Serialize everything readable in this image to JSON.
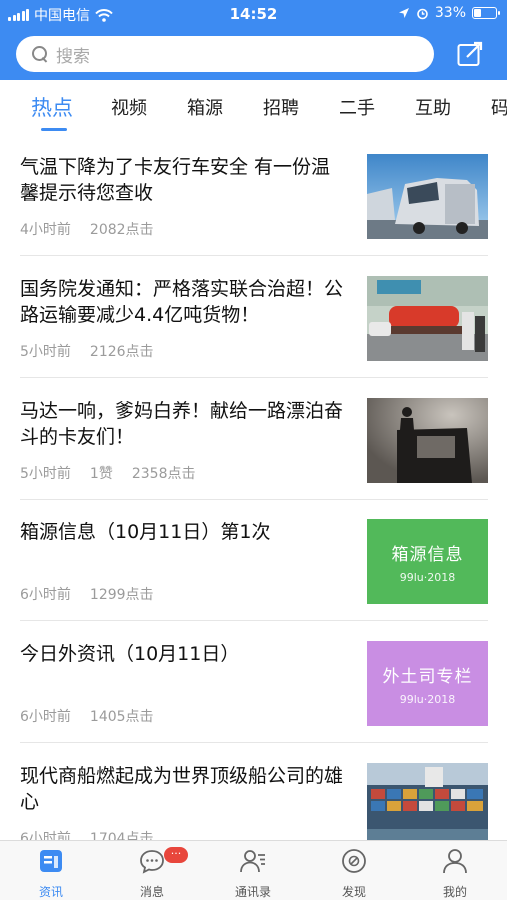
{
  "status_bar": {
    "carrier": "中国电信",
    "time": "14:52",
    "battery": "33%",
    "battery_level": 0.33
  },
  "header": {
    "search_placeholder": "搜索",
    "edit_icon": "compose-icon"
  },
  "tabs": [
    {
      "label": "热点",
      "active": true
    },
    {
      "label": "视频"
    },
    {
      "label": "箱源"
    },
    {
      "label": "招聘"
    },
    {
      "label": "二手"
    },
    {
      "label": "互助"
    },
    {
      "label": "码"
    }
  ],
  "articles": [
    {
      "title": "气温下降为了卡友行车安全 有一份温馨提示待您查收",
      "time": "4小时前",
      "clicks": "2082点击",
      "thumb": "truck-photo"
    },
    {
      "title": "国务院发通知：严格落实联合治超！公路运输要减少4.4亿吨货物！",
      "time": "5小时前",
      "clicks": "2126点击",
      "thumb": "tanker-truck-photo"
    },
    {
      "title": "马达一响，爹妈白养！献给一路漂泊奋斗的卡友们！",
      "time": "5小时前",
      "likes": "1赞",
      "clicks": "2358点击",
      "thumb": "silhouette-photo"
    },
    {
      "title": "箱源信息（10月11日）第1次",
      "time": "6小时前",
      "clicks": "1299点击",
      "thumb_text": "箱源信息",
      "thumb_sub": "99lu·2018",
      "thumb_color": "#52b95a"
    },
    {
      "title": "今日外资讯（10月11日）",
      "time": "6小时前",
      "clicks": "1405点击",
      "thumb_text": "外土司专栏",
      "thumb_sub": "99lu·2018",
      "thumb_color": "#c98ee3"
    },
    {
      "title": "现代商船燃起成为世界顶级船公司的雄心",
      "time": "6小时前",
      "clicks": "1704点击",
      "thumb": "container-ship-photo"
    }
  ],
  "bottom_nav": [
    {
      "label": "资讯",
      "icon": "news-icon",
      "active": true
    },
    {
      "label": "消息",
      "icon": "chat-icon",
      "badge": "···"
    },
    {
      "label": "通讯录",
      "icon": "contacts-icon"
    },
    {
      "label": "发现",
      "icon": "discover-icon"
    },
    {
      "label": "我的",
      "icon": "profile-icon"
    }
  ],
  "colors": {
    "brand": "#3d8bf2",
    "badge": "#e8463c",
    "meta_text": "#9b9b9b"
  }
}
